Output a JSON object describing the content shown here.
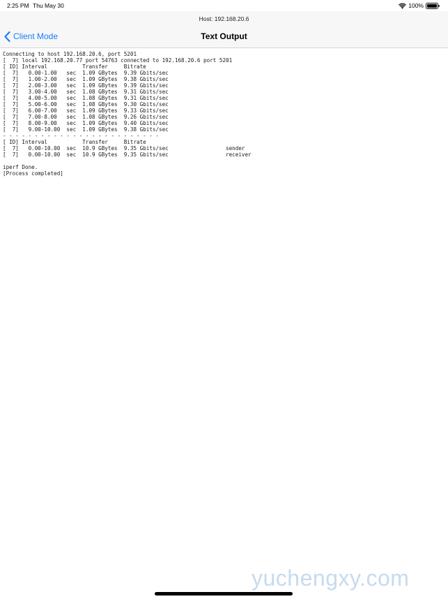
{
  "status_bar": {
    "time": "2:25 PM",
    "date": "Thu May 30",
    "battery_percent": "100%",
    "battery_level": 1.0
  },
  "nav": {
    "host": "Host: 192.168.20.6",
    "back_label": "Client Mode",
    "title": "Text Output"
  },
  "output": {
    "lines": [
      "Connecting to host 192.168.20.6, port 5201",
      "[  7] local 192.168.20.77 port 54763 connected to 192.168.20.6 port 5201",
      "[ ID] Interval           Transfer     Bitrate",
      "[  7]   0.00-1.00   sec  1.09 GBytes  9.39 Gbits/sec",
      "[  7]   1.00-2.00   sec  1.09 GBytes  9.38 Gbits/sec",
      "[  7]   2.00-3.00   sec  1.09 GBytes  9.39 Gbits/sec",
      "[  7]   3.00-4.00   sec  1.08 GBytes  9.31 Gbits/sec",
      "[  7]   4.00-5.00   sec  1.08 GBytes  9.31 Gbits/sec",
      "[  7]   5.00-6.00   sec  1.08 GBytes  9.30 Gbits/sec",
      "[  7]   6.00-7.00   sec  1.09 GBytes  9.33 Gbits/sec",
      "[  7]   7.00-8.00   sec  1.08 GBytes  9.26 Gbits/sec",
      "[  7]   8.00-9.00   sec  1.09 GBytes  9.40 Gbits/sec",
      "[  7]   9.00-10.00  sec  1.09 GBytes  9.38 Gbits/sec",
      "- - - - - - - - - - - - - - - - - - - - - - - - -",
      "[ ID] Interval           Transfer     Bitrate",
      "[  7]   0.00-10.00  sec  10.9 GBytes  9.35 Gbits/sec                  sender",
      "[  7]   0.00-10.00  sec  10.9 GBytes  9.35 Gbits/sec                  receiver",
      "",
      "iperf Done.",
      "[Process completed]"
    ]
  },
  "watermark": "yuchengxy.com",
  "colors": {
    "accent": "#1a7cf5",
    "nav_background": "#f7f7f8",
    "watermark": "#b3cfe8"
  },
  "icons": {
    "wifi": "wifi-icon",
    "battery": "battery-icon",
    "back": "chevron-left-icon"
  }
}
